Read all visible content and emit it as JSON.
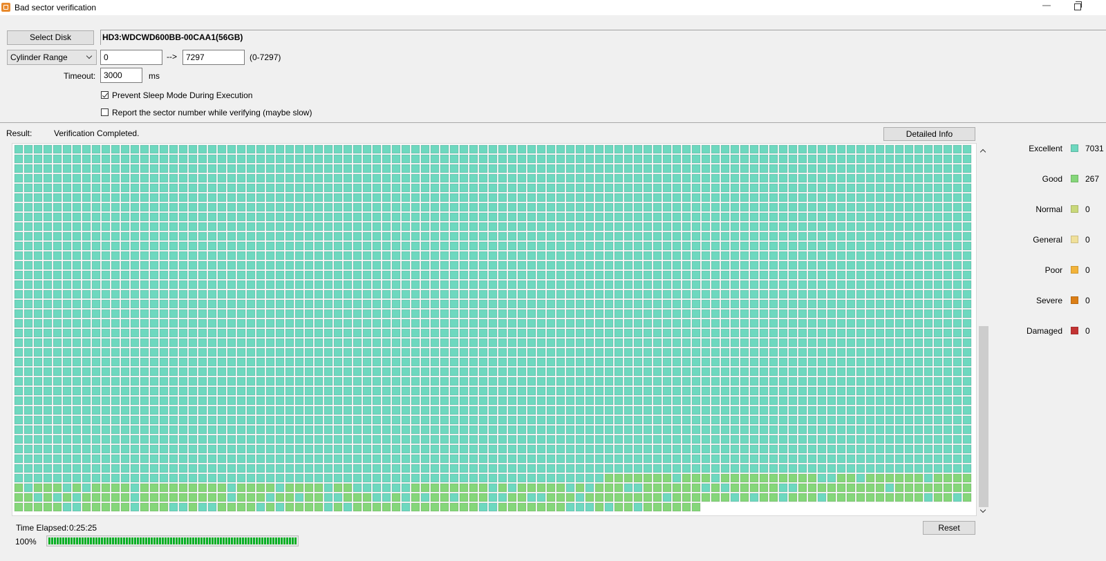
{
  "window": {
    "title": "Bad sector verification",
    "minimize": "—"
  },
  "header": {
    "select_disk_label": "Select Disk",
    "disk_name": "HD3:WDCWD600BB-00CAA1(56GB)",
    "range_mode": "Cylinder Range",
    "range_start": "0",
    "range_arrow": "-->",
    "range_end": "7297",
    "range_hint": "(0-7297)",
    "timeout_label": "Timeout:",
    "timeout_value": "3000",
    "timeout_unit": "ms",
    "prevent_sleep_label": "Prevent Sleep Mode During Execution",
    "prevent_sleep_checked": true,
    "report_sector_label": "Report the sector number while verifying (maybe slow)",
    "report_sector_checked": false
  },
  "result": {
    "label": "Result:",
    "status": "Verification Completed.",
    "detailed_info_label": "Detailed Info"
  },
  "legend": [
    {
      "label": "Excellent",
      "count": "7031",
      "color": "#6ed8bf"
    },
    {
      "label": "Good",
      "count": "267",
      "color": "#85d67a"
    },
    {
      "label": "Normal",
      "count": "0",
      "color": "#c9d87a"
    },
    {
      "label": "General",
      "count": "0",
      "color": "#f0e09a"
    },
    {
      "label": "Poor",
      "count": "0",
      "color": "#f2b33a"
    },
    {
      "label": "Severe",
      "count": "0",
      "color": "#db7e16"
    },
    {
      "label": "Damaged",
      "count": "0",
      "color": "#c33434"
    }
  ],
  "footer": {
    "time_label": "Time Elapsed:",
    "time_value": "0:25:25",
    "percent": "100%",
    "progress": 1.0,
    "reset_label": "Reset"
  }
}
